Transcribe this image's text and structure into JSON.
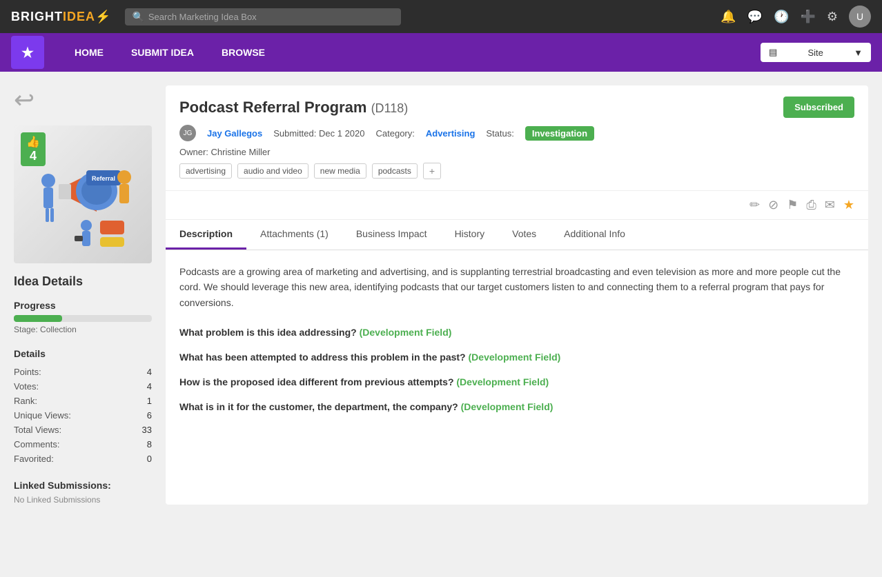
{
  "topBar": {
    "logo": "BRIGHTIDEA",
    "searchPlaceholder": "Search Marketing Idea Box",
    "icons": [
      "bell",
      "chat",
      "clock",
      "plus",
      "gear"
    ],
    "avatarInitial": "U"
  },
  "purpleNav": {
    "logoChar": "★",
    "navItems": [
      "HOME",
      "SUBMIT IDEA",
      "BROWSE"
    ],
    "siteSelector": {
      "icon": "▤",
      "label": "Site",
      "arrow": "▼"
    }
  },
  "idea": {
    "title": "Podcast Referral Program",
    "id": "(D118)",
    "subscribedLabel": "Subscribed",
    "meta": {
      "authorName": "Jay Gallegos",
      "submittedLabel": "Submitted:",
      "submittedDate": "Dec 1 2020",
      "categoryLabel": "Category:",
      "category": "Advertising",
      "statusLabel": "Status:",
      "status": "Investigation"
    },
    "ownerLabel": "Owner:",
    "ownerName": "Christine Miller",
    "tags": [
      "advertising",
      "audio and video",
      "new media",
      "podcasts"
    ],
    "addTagLabel": "+"
  },
  "actionIcons": {
    "edit": "✏",
    "link": "⊘",
    "flag": "⚑",
    "print": "⎙",
    "email": "✉",
    "star": "★"
  },
  "tabs": {
    "items": [
      {
        "label": "Description",
        "active": true
      },
      {
        "label": "Attachments (1)",
        "active": false
      },
      {
        "label": "Business Impact",
        "active": false
      },
      {
        "label": "History",
        "active": false
      },
      {
        "label": "Votes",
        "active": false
      },
      {
        "label": "Additional Info",
        "active": false
      }
    ]
  },
  "description": {
    "text": "Podcasts are a growing area of marketing and advertising, and is supplanting terrestrial broadcasting and even television as more and more people cut the cord. We should leverage this new area, identifying podcasts that our target customers listen to and connecting them to a referral program that pays for conversions.",
    "questions": [
      {
        "question": "What problem is this idea addressing?",
        "fieldLabel": "(Development Field)"
      },
      {
        "question": "What has been attempted to address this problem in the past?",
        "fieldLabel": "(Development Field)"
      },
      {
        "question": "How is the proposed idea different from previous attempts?",
        "fieldLabel": "(Development Field)"
      },
      {
        "question": "What is in it for the customer, the department, the company?",
        "fieldLabel": "(Development Field)"
      }
    ]
  },
  "sidebar": {
    "ideaDetailsTitle": "Idea Details",
    "progress": {
      "label": "Progress",
      "stageLabel": "Stage:",
      "stageName": "Collection",
      "fillPercent": 35
    },
    "details": {
      "title": "Details",
      "rows": [
        {
          "label": "Points:",
          "value": "4"
        },
        {
          "label": "Votes:",
          "value": "4"
        },
        {
          "label": "Rank:",
          "value": "1"
        },
        {
          "label": "Unique Views:",
          "value": "6"
        },
        {
          "label": "Total Views:",
          "value": "33"
        },
        {
          "label": "Comments:",
          "value": "8"
        },
        {
          "label": "Favorited:",
          "value": "0"
        }
      ]
    },
    "linked": {
      "title": "Linked Submissions:",
      "noLinkedText": "No Linked Submissions"
    },
    "voteCount": "4",
    "voteThumb": "👍"
  }
}
